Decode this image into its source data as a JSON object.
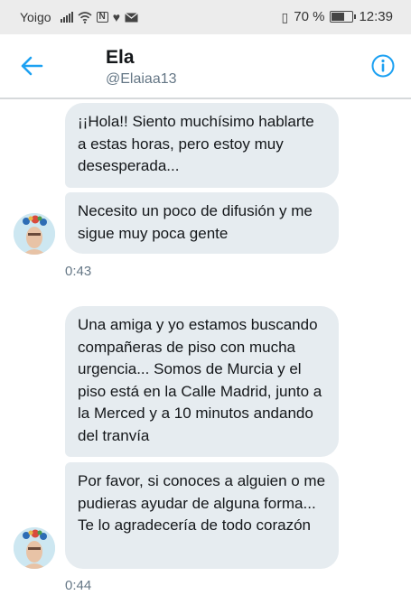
{
  "status_bar": {
    "carrier": "Yoigo",
    "battery": "70 %",
    "battery_level": 0.7,
    "time": "12:39"
  },
  "header": {
    "name": "Ela",
    "handle": "@Elaiaa13"
  },
  "messages": [
    {
      "text": "¡¡Hola!! Siento muchísimo hablarte a estas horas, pero estoy muy desesperada..."
    },
    {
      "text": "Necesito un poco de difusión y me sigue muy poca gente",
      "timestamp": "0:43"
    },
    {
      "text": "Una amiga y yo estamos buscando compañeras de piso con mucha urgencia... Somos de Murcia y el piso está en la Calle Madrid, junto a la Merced y a 10 minutos andando del tranvía"
    },
    {
      "text": "Por favor, si conoces a alguien o me pudieras ayudar de alguna forma... Te lo agradecería de todo corazón",
      "timestamp": "0:44"
    }
  ],
  "colors": {
    "accent": "#1da1f2",
    "bubble": "#e6ecf0",
    "muted": "#657786"
  }
}
